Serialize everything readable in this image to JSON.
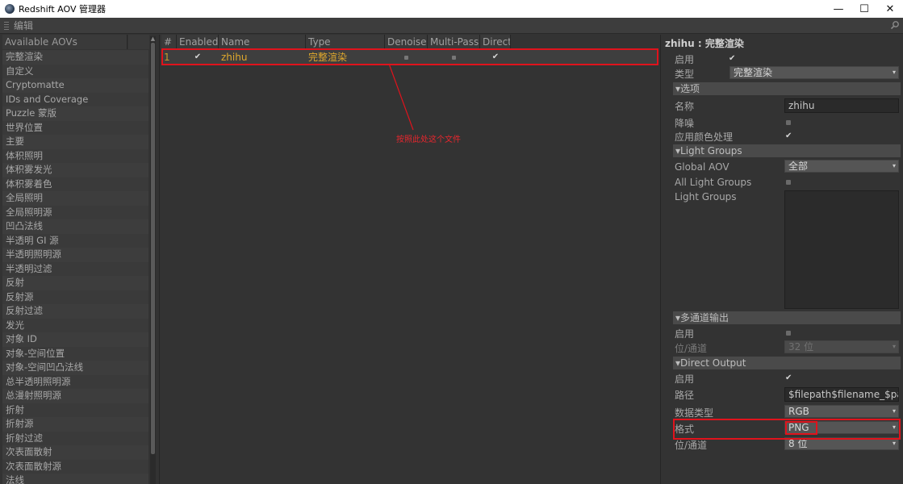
{
  "window": {
    "title": "Redshift AOV 管理器",
    "controls": {
      "minimize": "—",
      "maximize": "☐",
      "close": "✕"
    }
  },
  "menu": {
    "edit": "编辑"
  },
  "left_panel": {
    "header": "Available AOVs",
    "items": [
      "完整渲染",
      "自定义",
      "Cryptomatte",
      "IDs and Coverage",
      "Puzzle 蒙版",
      "世界位置",
      "主要",
      "体积照明",
      "体积雾发光",
      "体积雾着色",
      "全局照明",
      "全局照明源",
      "凹凸法线",
      "半透明 GI 源",
      "半透明照明源",
      "半透明过滤",
      "反射",
      "反射源",
      "反射过滤",
      "发光",
      "对象 ID",
      "对象-空间位置",
      "对象-空间凹凸法线",
      "总半透明照明源",
      "总漫射照明源",
      "折射",
      "折射源",
      "折射过滤",
      "次表面散射",
      "次表面散射源",
      "法线"
    ]
  },
  "aov_table": {
    "columns": [
      "#",
      "Enabled",
      "Name",
      "Type",
      "Denoise",
      "Multi-Pass",
      "Direct"
    ],
    "rows": [
      {
        "num": "1",
        "enabled": "✔",
        "name": "zhihu",
        "type": "完整渲染",
        "denoise": false,
        "multipass": false,
        "direct": "✔"
      }
    ]
  },
  "annotation": {
    "text": "按照此处这个文件"
  },
  "properties": {
    "title": "zhihu : 完整渲染",
    "enable_label": "启用",
    "enable_check": "✔",
    "type_label": "类型",
    "type_value": "完整渲染",
    "options_section": "▾选项",
    "name_label": "名称",
    "name_value": "zhihu",
    "denoise_label": "降噪",
    "color_proc_label": "应用颜色处理",
    "color_proc_check": "✔",
    "light_groups_section": "▾Light Groups",
    "global_aov_label": "Global AOV",
    "global_aov_value": "全部",
    "all_light_groups_label": "All Light Groups",
    "light_groups_label": "Light Groups",
    "multipass_section": "▾多通道输出",
    "mp_enable_label": "启用",
    "mp_bits_label": "位/通道",
    "mp_bits_value": "32 位",
    "direct_section": "▾Direct Output",
    "do_enable_label": "启用",
    "do_enable_check": "✔",
    "path_label": "路径",
    "path_value": "$filepath$filename_$pass",
    "datatype_label": "数据类型",
    "datatype_value": "RGB",
    "format_label": "格式",
    "format_value": "PNG",
    "bits_label": "位/通道",
    "bits_value": "8 位"
  },
  "colors": {
    "accent_orange": "#e0a82d",
    "annotation_red": "#e0131c",
    "background": "#333333"
  }
}
